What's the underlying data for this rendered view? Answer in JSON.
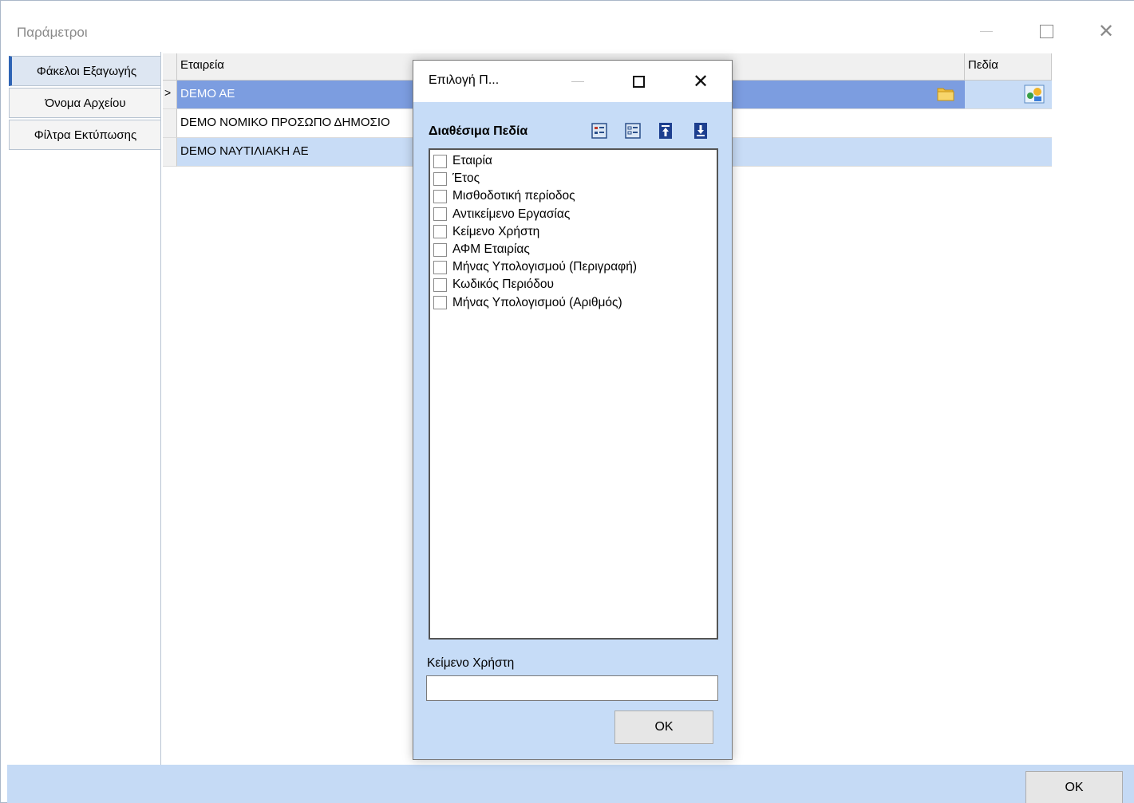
{
  "window": {
    "title": "Παράμετροι"
  },
  "tabs": [
    {
      "label": "Φάκελοι Εξαγωγής",
      "active": true
    },
    {
      "label": "Όνομα Αρχείου",
      "active": false
    },
    {
      "label": "Φίλτρα Εκτύπωσης",
      "active": false
    }
  ],
  "grid": {
    "columns": [
      "Εταιρεία",
      "",
      "Πεδία"
    ],
    "rows": [
      {
        "company": "DEMO AE",
        "selected": true
      },
      {
        "company": "DEMO ΝΟΜΙΚΟ ΠΡΟΣΩΠΟ ΔΗΜΟΣΙΟ",
        "selected": false
      },
      {
        "company": "DEMO ΝΑΥΤΙΛΙΑΚΗ ΑΕ",
        "selected": false
      }
    ],
    "row_indicator": ">"
  },
  "main_ok_label": "OK",
  "dialog": {
    "title": "Επιλογή Π...",
    "available_fields_label": "Διαθέσιμα Πεδία",
    "toolbar_icons": [
      "select-all-icon",
      "deselect-all-icon",
      "move-top-icon",
      "move-bottom-icon"
    ],
    "fields": [
      "Εταιρία",
      "Έτος",
      "Μισθοδοτική περίοδος",
      "Αντικείμενο Εργασίας",
      "Κείμενο Χρήστη",
      "ΑΦΜ Εταιρίας",
      "Μήνας Υπολογισμού (Περιγραφή)",
      "Κωδικός Περιόδου",
      "Μήνας Υπολογισμού (Αριθμός)"
    ],
    "user_text_label": "Κείμενο Χρήστη",
    "user_text_value": "",
    "ok_label": "OK"
  },
  "colors": {
    "selected_row": "#7c9de0",
    "alt_row": "#c8dcf6",
    "dialog_bg": "#c6dcf7",
    "active_tab_accent": "#2e64b5"
  }
}
